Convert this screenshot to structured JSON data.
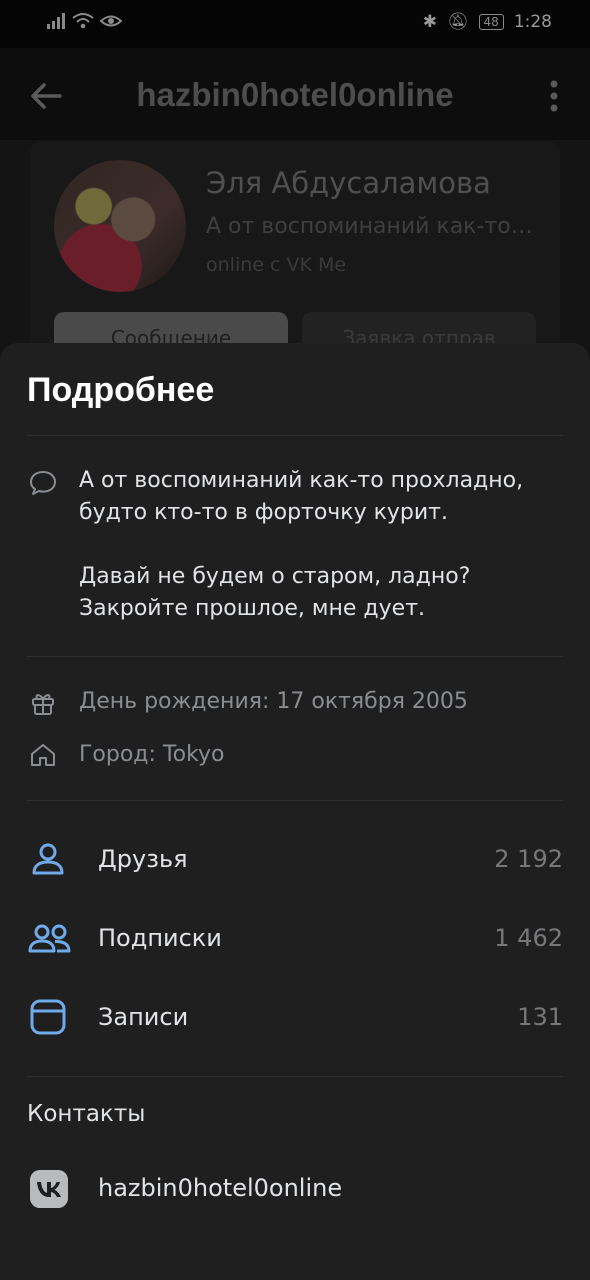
{
  "status_bar": {
    "time": "1:28",
    "battery": "48"
  },
  "header": {
    "title": "hazbin0hotel0online"
  },
  "profile": {
    "name": "Эля Абдусаламова",
    "status": "А от воспоминаний как-то ...",
    "online": "online с VK Me",
    "message_button": "Сообщение",
    "request_button": "Заявка отправ"
  },
  "sheet": {
    "title": "Подробнее",
    "about_lines": [
      "А от воспоминаний как-то прохладно,",
      "будто кто-то в форточку курит.",
      "Давай не будем о старом, ладно?",
      "Закройте прошлое, мне дует."
    ],
    "birthday": "День рождения: 17 октября 2005",
    "city": "Город: Tokyo",
    "counters": [
      {
        "label": "Друзья",
        "value": "2 192",
        "icon": "user-icon"
      },
      {
        "label": "Подписки",
        "value": "1 462",
        "icon": "users-icon"
      },
      {
        "label": "Записи",
        "value": "131",
        "icon": "posts-icon"
      }
    ],
    "contacts_title": "Контакты",
    "contact_vk": "hazbin0hotel0online"
  },
  "colors": {
    "accent": "#71aaeb",
    "sheet_bg": "#1f1f1f"
  }
}
